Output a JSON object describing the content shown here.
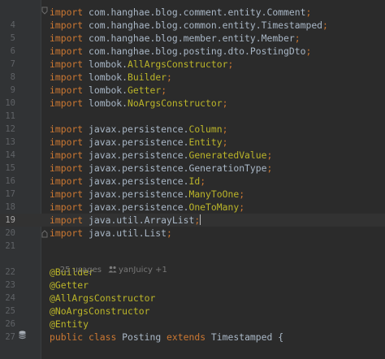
{
  "editor": {
    "lines": [
      {
        "no": "",
        "parts": [
          {
            "t": "import ",
            "c": "kw"
          },
          {
            "t": "com.hanghae.blog.comment.entity.Comment",
            "c": "pkg"
          },
          {
            "t": ";",
            "c": "kw"
          }
        ]
      },
      {
        "no": "4",
        "parts": [
          {
            "t": "import ",
            "c": "kw"
          },
          {
            "t": "com.hanghae.blog.common.entity.Timestamped",
            "c": "pkg"
          },
          {
            "t": ";",
            "c": "kw"
          }
        ]
      },
      {
        "no": "5",
        "parts": [
          {
            "t": "import ",
            "c": "kw"
          },
          {
            "t": "com.hanghae.blog.member.entity.Member",
            "c": "pkg"
          },
          {
            "t": ";",
            "c": "kw"
          }
        ]
      },
      {
        "no": "6",
        "parts": [
          {
            "t": "import ",
            "c": "kw"
          },
          {
            "t": "com.hanghae.blog.posting.dto.PostingDto",
            "c": "pkg"
          },
          {
            "t": ";",
            "c": "kw"
          }
        ]
      },
      {
        "no": "7",
        "parts": [
          {
            "t": "import ",
            "c": "kw"
          },
          {
            "t": "lombok.",
            "c": "pkg"
          },
          {
            "t": "AllArgsConstructor",
            "c": "yel"
          },
          {
            "t": ";",
            "c": "kw"
          }
        ]
      },
      {
        "no": "8",
        "parts": [
          {
            "t": "import ",
            "c": "kw"
          },
          {
            "t": "lombok.",
            "c": "pkg"
          },
          {
            "t": "Builder",
            "c": "yel"
          },
          {
            "t": ";",
            "c": "kw"
          }
        ]
      },
      {
        "no": "9",
        "parts": [
          {
            "t": "import ",
            "c": "kw"
          },
          {
            "t": "lombok.",
            "c": "pkg"
          },
          {
            "t": "Getter",
            "c": "yel"
          },
          {
            "t": ";",
            "c": "kw"
          }
        ]
      },
      {
        "no": "10",
        "parts": [
          {
            "t": "import ",
            "c": "kw"
          },
          {
            "t": "lombok.",
            "c": "pkg"
          },
          {
            "t": "NoArgsConstructor",
            "c": "yel"
          },
          {
            "t": ";",
            "c": "kw"
          }
        ]
      },
      {
        "no": "11",
        "parts": []
      },
      {
        "no": "12",
        "parts": [
          {
            "t": "import ",
            "c": "kw"
          },
          {
            "t": "javax.persistence.",
            "c": "pkg"
          },
          {
            "t": "Column",
            "c": "yel"
          },
          {
            "t": ";",
            "c": "kw"
          }
        ]
      },
      {
        "no": "13",
        "parts": [
          {
            "t": "import ",
            "c": "kw"
          },
          {
            "t": "javax.persistence.",
            "c": "pkg"
          },
          {
            "t": "Entity",
            "c": "yel"
          },
          {
            "t": ";",
            "c": "kw"
          }
        ]
      },
      {
        "no": "14",
        "parts": [
          {
            "t": "import ",
            "c": "kw"
          },
          {
            "t": "javax.persistence.",
            "c": "pkg"
          },
          {
            "t": "GeneratedValue",
            "c": "yel"
          },
          {
            "t": ";",
            "c": "kw"
          }
        ]
      },
      {
        "no": "15",
        "parts": [
          {
            "t": "import ",
            "c": "kw"
          },
          {
            "t": "javax.persistence.",
            "c": "pkg"
          },
          {
            "t": "GenerationType",
            "c": "pkg"
          },
          {
            "t": ";",
            "c": "kw"
          }
        ]
      },
      {
        "no": "16",
        "parts": [
          {
            "t": "import ",
            "c": "kw"
          },
          {
            "t": "javax.persistence.",
            "c": "pkg"
          },
          {
            "t": "Id",
            "c": "yel"
          },
          {
            "t": ";",
            "c": "kw"
          }
        ]
      },
      {
        "no": "17",
        "parts": [
          {
            "t": "import ",
            "c": "kw"
          },
          {
            "t": "javax.persistence.",
            "c": "pkg"
          },
          {
            "t": "ManyToOne",
            "c": "yel"
          },
          {
            "t": ";",
            "c": "kw"
          }
        ]
      },
      {
        "no": "18",
        "parts": [
          {
            "t": "import ",
            "c": "kw"
          },
          {
            "t": "javax.persistence.",
            "c": "pkg"
          },
          {
            "t": "OneToMany",
            "c": "yel"
          },
          {
            "t": ";",
            "c": "kw"
          }
        ]
      },
      {
        "no": "19",
        "current": true,
        "parts": [
          {
            "t": "import ",
            "c": "kw"
          },
          {
            "t": "java.util.ArrayList",
            "c": "pkg"
          },
          {
            "t": ";",
            "c": "kw"
          }
        ]
      },
      {
        "no": "20",
        "parts": [
          {
            "t": "import ",
            "c": "kw"
          },
          {
            "t": "java.util.List",
            "c": "pkg"
          },
          {
            "t": ";",
            "c": "kw"
          }
        ]
      },
      {
        "no": "21",
        "parts": []
      },
      {
        "no": "",
        "parts": []
      },
      {
        "no": "22",
        "parts": [
          {
            "t": "@Builder",
            "c": "ann"
          }
        ]
      },
      {
        "no": "23",
        "parts": [
          {
            "t": "@Getter",
            "c": "ann"
          }
        ]
      },
      {
        "no": "24",
        "parts": [
          {
            "t": "@AllArgsConstructor",
            "c": "ann"
          }
        ]
      },
      {
        "no": "25",
        "parts": [
          {
            "t": "@NoArgsConstructor",
            "c": "ann"
          }
        ]
      },
      {
        "no": "26",
        "parts": [
          {
            "t": "@Entity",
            "c": "ann"
          }
        ]
      },
      {
        "no": "27",
        "parts": [
          {
            "t": "public ",
            "c": "kw"
          },
          {
            "t": "class ",
            "c": "kw"
          },
          {
            "t": "Posting ",
            "c": "cls"
          },
          {
            "t": "extends ",
            "c": "kw"
          },
          {
            "t": "Timestamped ",
            "c": "cls"
          },
          {
            "t": "{",
            "c": "pkg"
          }
        ]
      }
    ],
    "usage_hint": {
      "usages": "25 usages",
      "author": "yanJuicy +1"
    },
    "colors": {
      "background": "#2b2b2b",
      "gutter": "#313335",
      "keyword": "#cc7832",
      "annotation": "#bbb529",
      "text": "#a9b7c6",
      "line_number": "#5f6266"
    },
    "icons": [
      "fold-marker-icon",
      "database-icon",
      "people-icon"
    ]
  }
}
